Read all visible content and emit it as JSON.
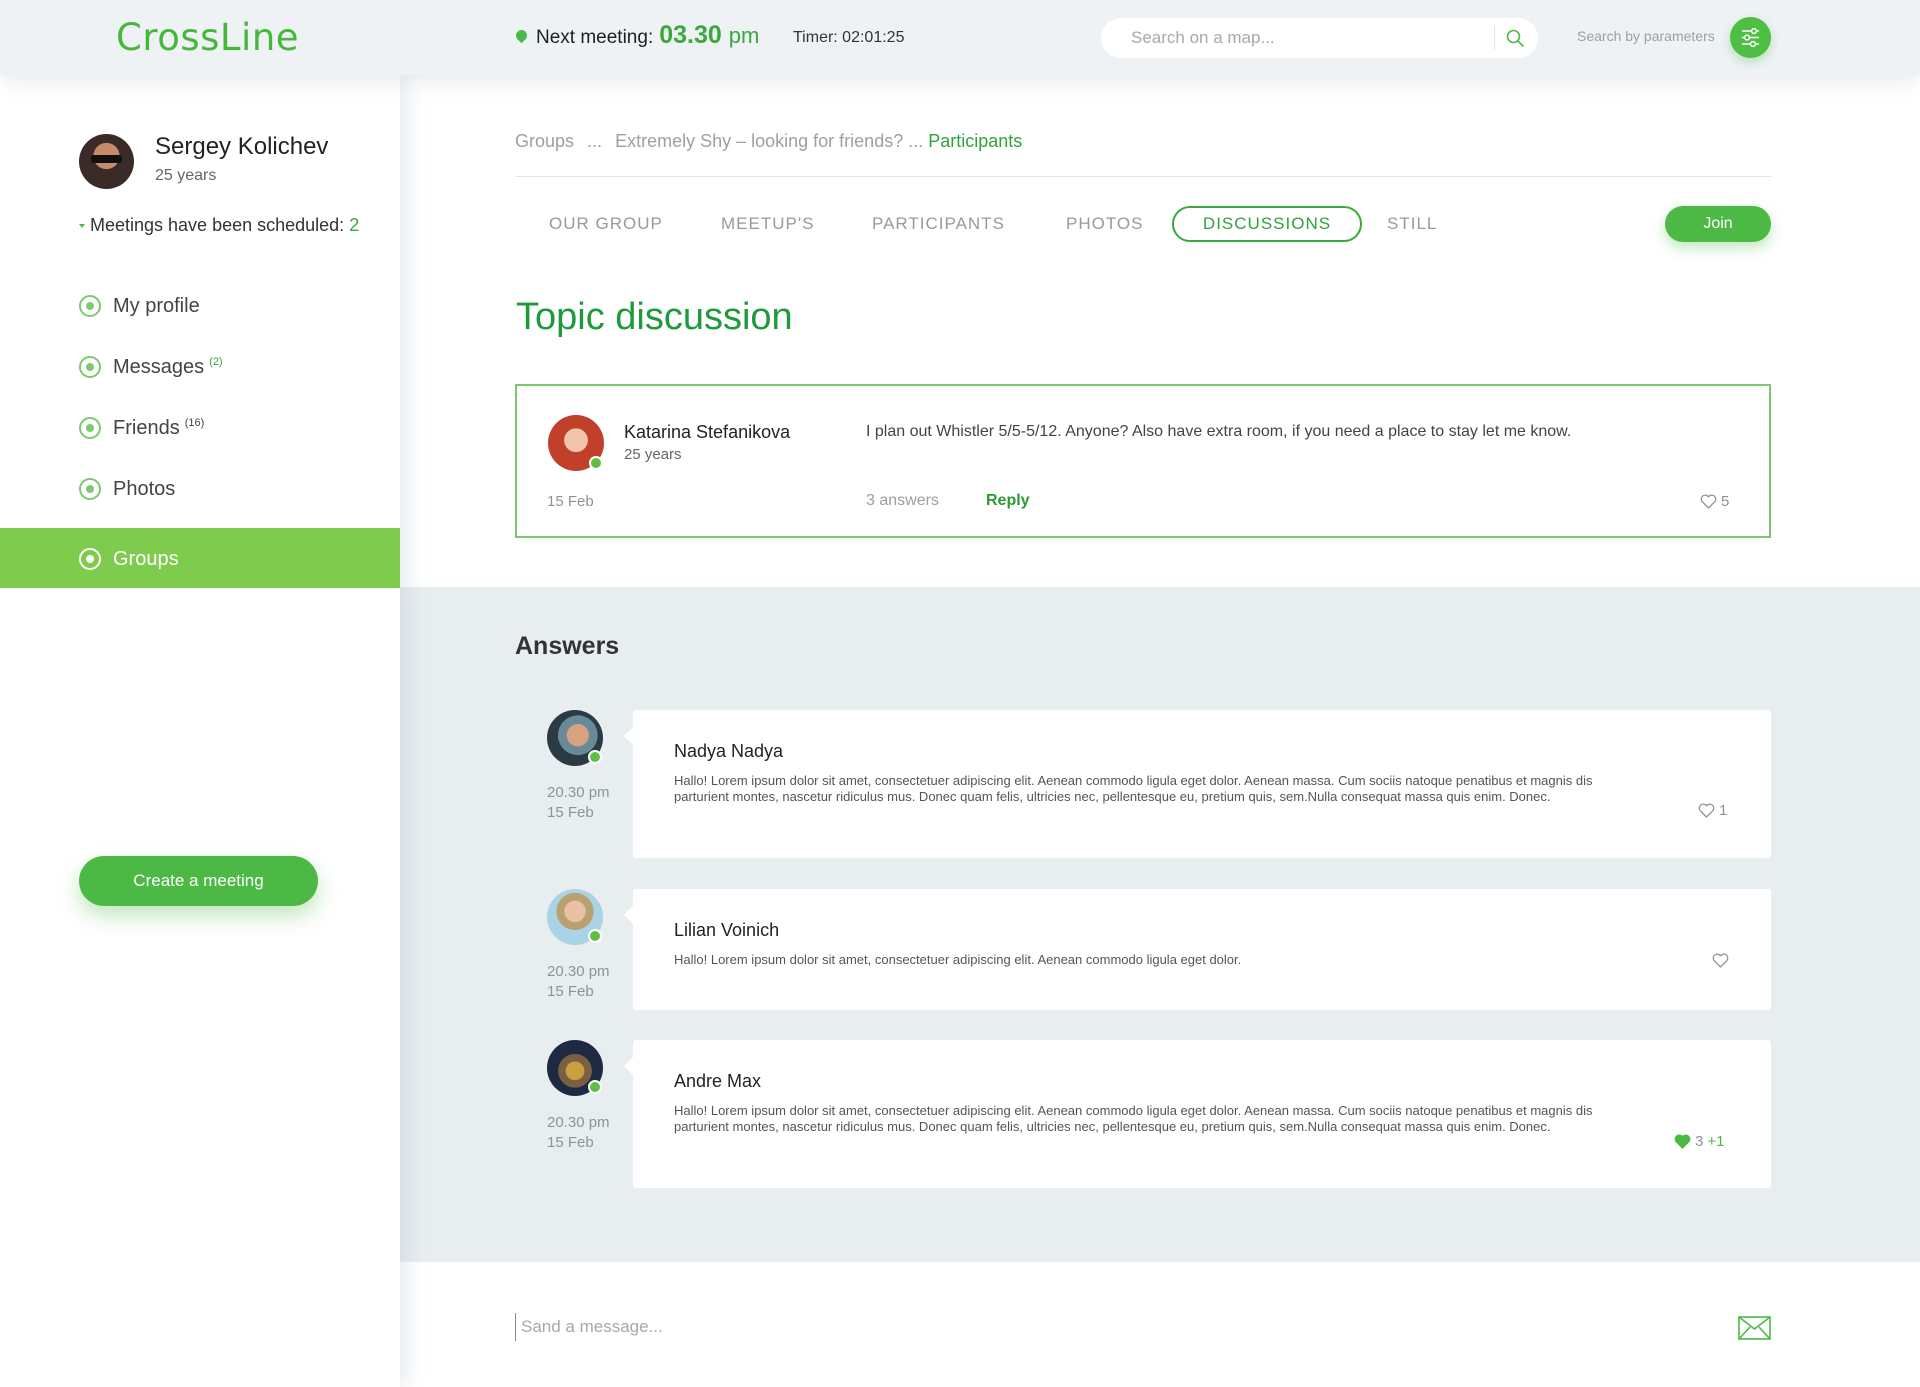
{
  "header": {
    "logo": "CrossLine",
    "next_meeting_label": "Next meeting:",
    "next_meeting_time": "03.30",
    "next_meeting_period": "pm",
    "timer": "Timer: 02:01:25",
    "search_placeholder": "Search on a map...",
    "search_by_parameters": "Search by parameters"
  },
  "user": {
    "name": "Sergey Kolichev",
    "age": "25 years",
    "meetings_label": "Meetings have been scheduled:",
    "meetings_count": "2"
  },
  "sidebar": {
    "items": [
      {
        "label": "My profile",
        "badge": "",
        "icon": "user-icon"
      },
      {
        "label": "Messages",
        "badge": "(2)",
        "icon": "envelope-icon"
      },
      {
        "label": "Friends",
        "badge": "(16)",
        "icon": "smile-icon"
      },
      {
        "label": "Photos",
        "badge": "",
        "icon": "camera-icon"
      },
      {
        "label": "Groups",
        "badge": "",
        "icon": "groups-icon",
        "active": true
      }
    ],
    "create_button": "Create a meeting"
  },
  "breadcrumb": {
    "root": "Groups",
    "sep1": "...",
    "group": "Extremely Shy – looking for friends?",
    "sep2": "...",
    "current": "Participants"
  },
  "tabs": [
    {
      "label": "OUR GROUP"
    },
    {
      "label": "MEETUP'S"
    },
    {
      "label": "PARTICIPANTS"
    },
    {
      "label": "PHOTOS"
    },
    {
      "label": "DISCUSSIONS",
      "active": true
    },
    {
      "label": "STILL"
    }
  ],
  "join_button": "Join",
  "topic": {
    "title": "Topic discussion",
    "author": "Katarina Stefanikova",
    "age": "25 years",
    "text": "I plan out Whistler 5/5-5/12. Anyone? Also have extra room, if you need a place to stay let me know.",
    "date": "15 Feb",
    "answers": "3 answers",
    "reply": "Reply",
    "likes": "5"
  },
  "answers": {
    "title": "Answers",
    "items": [
      {
        "name": "Nadya Nadya",
        "time": "20.30 pm",
        "date": "15 Feb",
        "text": "Hallo! Lorem ipsum dolor sit amet, consectetuer adipiscing elit. Aenean commodo ligula eget dolor. Aenean massa. Cum sociis natoque penatibus et magnis dis parturient montes,  nascetur ridiculus mus. Donec quam felis, ultricies nec, pellentesque eu, pretium quis, sem.Nulla consequat massa quis enim. Donec.",
        "likes": "1"
      },
      {
        "name": "Lilian Voinich",
        "time": "20.30 pm",
        "date": "15 Feb",
        "text": "Hallo! Lorem ipsum dolor sit amet, consectetuer adipiscing elit. Aenean commodo ligula eget dolor.",
        "likes": ""
      },
      {
        "name": "Andre Max",
        "time": "20.30 pm",
        "date": "15 Feb",
        "text": "Hallo! Lorem ipsum dolor sit amet, consectetuer adipiscing elit. Aenean commodo ligula eget dolor. Aenean massa. Cum sociis natoque penatibus et magnis dis parturient montes,  nascetur ridiculus mus. Donec quam felis, ultricies nec, pellentesque eu, pretium quis, sem.Nulla consequat massa quis enim. Donec.",
        "likes": "3",
        "likes_extra": "+1",
        "liked": true
      }
    ]
  },
  "message_placeholder": "Sand a message...",
  "colors": {
    "accent": "#4cb944",
    "title_green": "#1f9a3a",
    "active_nav": "#7fcb4d",
    "answers_bg": "#e8edf0"
  }
}
